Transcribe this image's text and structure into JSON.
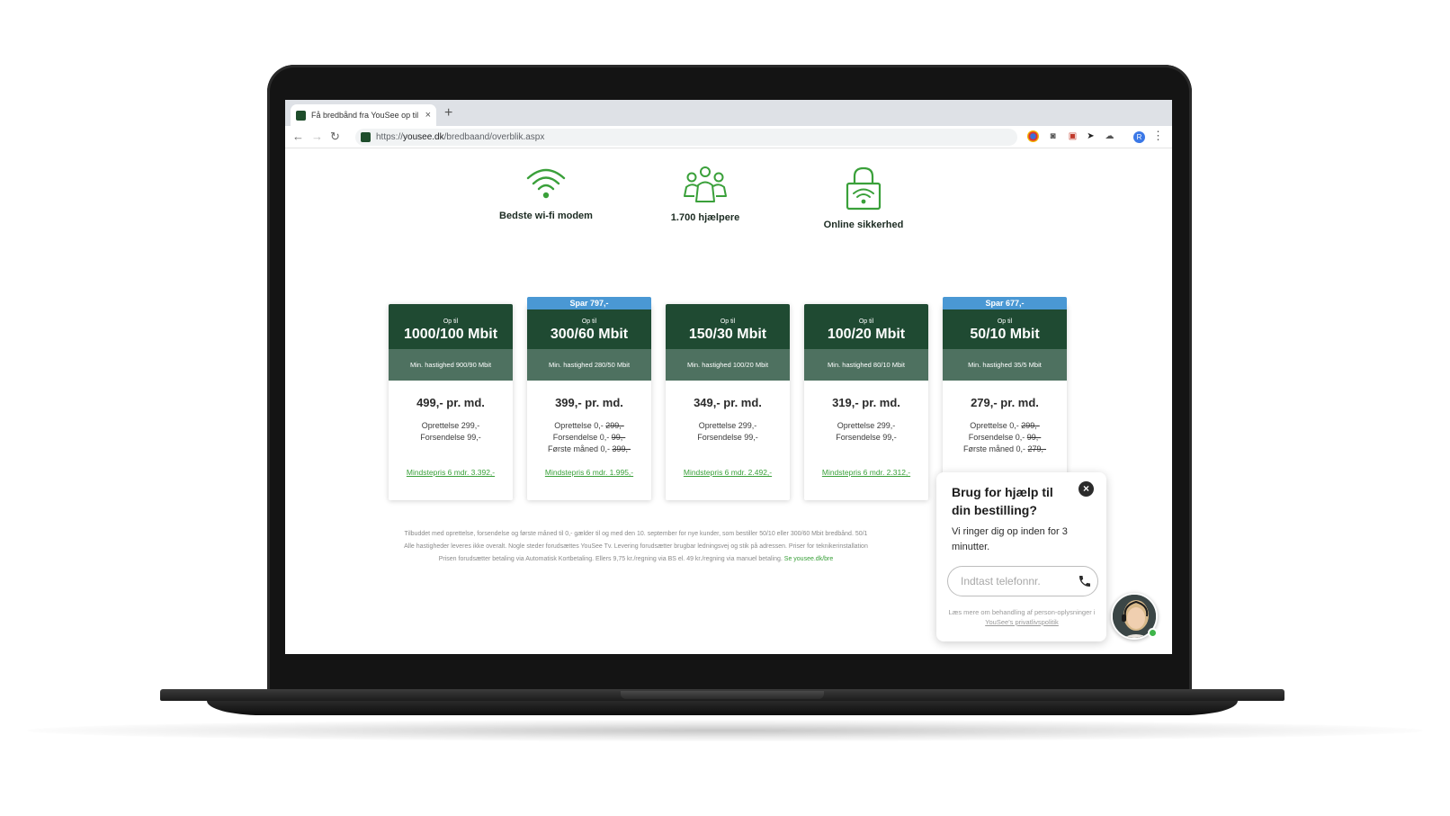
{
  "browser": {
    "tab_title": "Få bredbånd fra YouSee op til",
    "tab_close": "×",
    "new_tab": "+",
    "url_prefix": "https://",
    "url_host": "yousee.dk",
    "url_path": "/bredbaand/overblik.aspx",
    "profile_initial": "R"
  },
  "features": [
    {
      "label": "Bedste wi-fi modem",
      "icon": "wifi-icon"
    },
    {
      "label": "1.700 hjælpere",
      "icon": "people-group-icon"
    },
    {
      "label": "Online sikkerhed",
      "icon": "lock-wifi-icon"
    }
  ],
  "plans": [
    {
      "badge": "",
      "upto": "Op til",
      "speed": "1000/100 Mbit",
      "min_speed": "Min. hastighed 900/90 Mbit",
      "price": "499,- pr. md.",
      "fee1": "Oprettelse 299,-",
      "fee1_old": "",
      "fee2": "Forsendelse 99,-",
      "fee2_old": "",
      "fee3": "",
      "fee3_old": "",
      "min_price": "Mindstepris 6 mdr. 3.392,-"
    },
    {
      "badge": "Spar 797,-",
      "upto": "Op til",
      "speed": "300/60 Mbit",
      "min_speed": "Min. hastighed 280/50 Mbit",
      "price": "399,- pr. md.",
      "fee1": "Oprettelse 0,-",
      "fee1_old": "299,-",
      "fee2": "Forsendelse 0,-",
      "fee2_old": "99,-",
      "fee3": "Første måned 0,-",
      "fee3_old": "399,-",
      "min_price": "Mindstepris 6 mdr. 1.995,-"
    },
    {
      "badge": "",
      "upto": "Op til",
      "speed": "150/30 Mbit",
      "min_speed": "Min. hastighed 100/20 Mbit",
      "price": "349,- pr. md.",
      "fee1": "Oprettelse 299,-",
      "fee1_old": "",
      "fee2": "Forsendelse 99,-",
      "fee2_old": "",
      "fee3": "",
      "fee3_old": "",
      "min_price": "Mindstepris 6 mdr. 2.492,-"
    },
    {
      "badge": "",
      "upto": "Op til",
      "speed": "100/20 Mbit",
      "min_speed": "Min. hastighed 80/10 Mbit",
      "price": "319,- pr. md.",
      "fee1": "Oprettelse 299,-",
      "fee1_old": "",
      "fee2": "Forsendelse 99,-",
      "fee2_old": "",
      "fee3": "",
      "fee3_old": "",
      "min_price": "Mindstepris 6 mdr. 2.312,-"
    },
    {
      "badge": "Spar 677,-",
      "upto": "Op til",
      "speed": "50/10 Mbit",
      "min_speed": "Min. hastighed 35/5 Mbit",
      "price": "279,- pr. md.",
      "fee1": "Oprettelse 0,-",
      "fee1_old": "299,-",
      "fee2": "Forsendelse 0,-",
      "fee2_old": "99,-",
      "fee3": "Første måned 0,-",
      "fee3_old": "279,-",
      "min_price": ""
    }
  ],
  "disclaimer": {
    "line1": "Tilbuddet med oprettelse, forsendelse og første måned til 0,- gælder til og med den 10. september for nye kunder, som bestiller 50/10 eller 300/60 Mbit bredbånd. 50/1",
    "line2": "Alle hastigheder leveres ikke overalt. Nogle steder forudsættes YouSee Tv. Levering forudsætter brugbar ledningsvej og stik på adressen. Priser for teknikerinstallation",
    "line3": "Prisen forudsætter betaling via Automatisk Kortbetaling. Ellers 9,75 kr./regning via BS el. 49 kr./regning via manuel betaling.",
    "line3_link": "Se yousee.dk/bre"
  },
  "help_popup": {
    "title": "Brug for hjælp til din bestilling?",
    "close": "×",
    "text": "Vi ringer dig op inden for 3 minutter.",
    "phone_placeholder": "Indtast telefonnr.",
    "note": "Læs mere om behandling af person-oplysninger i",
    "note_link": "YouSee's privatlivspolitik"
  },
  "colors": {
    "brand_green": "#1f4a32",
    "min_speed_green": "#4e7160",
    "link_green": "#3aa03a",
    "badge_blue": "#4a98d4"
  }
}
